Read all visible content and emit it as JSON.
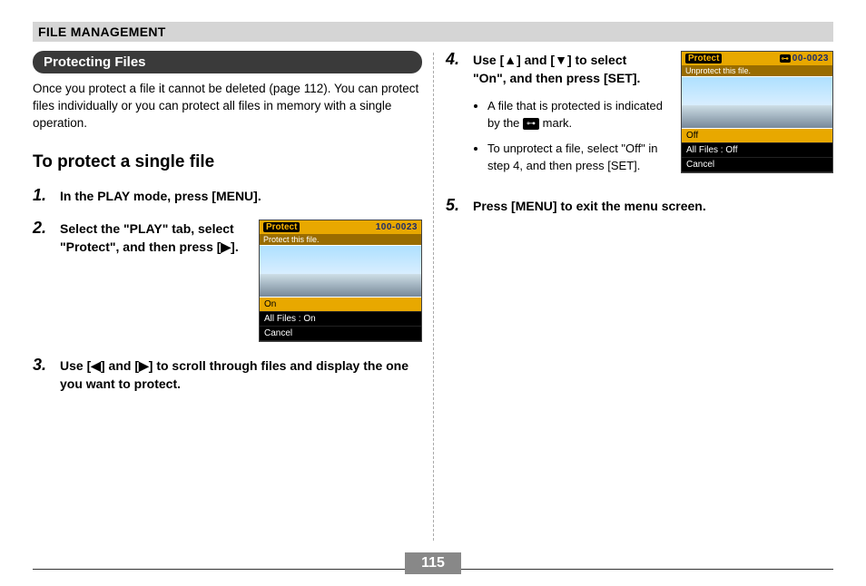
{
  "header": "FILE MANAGEMENT",
  "section_title": "Protecting Files",
  "intro": "Once you protect a file it cannot be deleted (page 112). You can protect files individually or you can protect all files in memory with a single operation.",
  "subhead": "To protect a single file",
  "steps": {
    "s1": {
      "num": "1.",
      "text": "In the PLAY mode, press [MENU]."
    },
    "s2": {
      "num": "2.",
      "text": "Select the \"PLAY\" tab, select \"Protect\", and then press [▶]."
    },
    "s3": {
      "num": "3.",
      "text": "Use [◀] and [▶] to scroll through files and display the one you want to protect."
    },
    "s4": {
      "num": "4.",
      "text": "Use [▲] and [▼] to select \"On\", and then press [SET].",
      "bullets": {
        "b1_pre": "A file that is protected is indicated by the ",
        "b1_post": " mark.",
        "b2": "To unprotect a file, select \"Off\" in step 4, and then press [SET]."
      }
    },
    "s5": {
      "num": "5.",
      "text": "Press [MENU] to exit the menu screen."
    }
  },
  "key_icon_label": "⊶",
  "lcd1": {
    "top_left": "Protect",
    "top_right": "100-0023",
    "sub": "Protect this file.",
    "menu": {
      "sel": "On",
      "row2": "All Files : On",
      "row3": "Cancel"
    }
  },
  "lcd2": {
    "top_left": "Protect",
    "top_right": "00-0023",
    "sub": "Unprotect this file.",
    "menu": {
      "sel": "Off",
      "row2": "All Files : Off",
      "row3": "Cancel"
    }
  },
  "page_number": "115"
}
